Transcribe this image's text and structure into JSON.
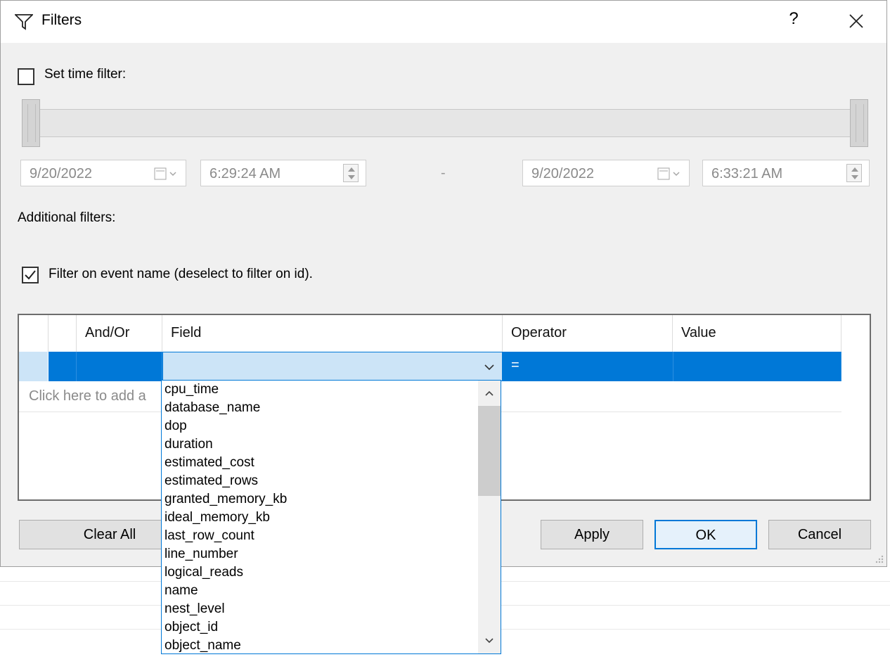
{
  "window": {
    "title": "Filters",
    "help_label": "?"
  },
  "time_filter": {
    "label": "Set time filter:",
    "checked": false,
    "start_date": "9/20/2022",
    "start_time": "6:29:24 AM",
    "separator": "-",
    "end_date": "9/20/2022",
    "end_time": "6:33:21 AM"
  },
  "additional_filters": {
    "label": "Additional filters:",
    "event_name_label": "Filter on event name (deselect to filter on id).",
    "event_name_checked": true
  },
  "grid": {
    "columns": [
      "And/Or",
      "Field",
      "Operator",
      "Value"
    ],
    "row": {
      "and_or": "",
      "field": "",
      "operator": "=",
      "value": ""
    },
    "add_row_text": "Click here to add a"
  },
  "field_dropdown": {
    "options": [
      "cpu_time",
      "database_name",
      "dop",
      "duration",
      "estimated_cost",
      "estimated_rows",
      "granted_memory_kb",
      "ideal_memory_kb",
      "last_row_count",
      "line_number",
      "logical_reads",
      "name",
      "nest_level",
      "object_id",
      "object_name"
    ]
  },
  "buttons": {
    "clear_all": "Clear All",
    "apply": "Apply",
    "ok": "OK",
    "cancel": "Cancel"
  },
  "colors": {
    "selection": "#0078d7",
    "selection_light": "#cce4f7",
    "dialog_bg": "#f0f0f0"
  }
}
